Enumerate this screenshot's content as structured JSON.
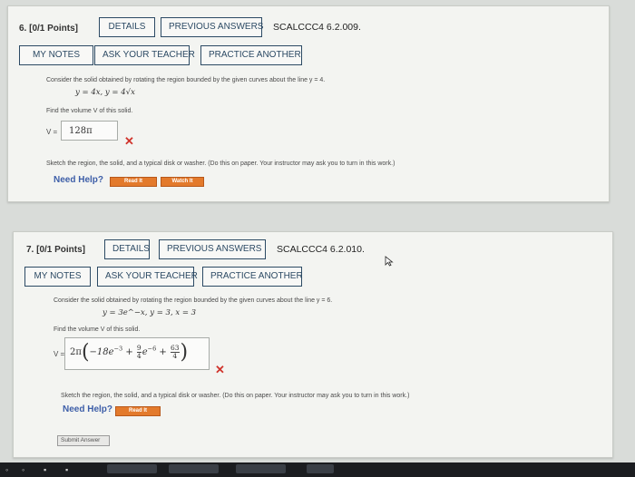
{
  "q6": {
    "points": "6. [0/1 Points]",
    "details": "DETAILS",
    "prev_answers": "PREVIOUS ANSWERS",
    "ref": "SCALCCC4 6.2.009.",
    "my_notes": "MY NOTES",
    "ask_teacher": "ASK YOUR TEACHER",
    "practice": "PRACTICE ANOTHER",
    "question": "Consider the solid obtained by rotating the region bounded by the given curves about the line y = 4.",
    "curves": "y = 4x,  y = 4√x",
    "find": "Find the volume V of this solid.",
    "v_label": "V =",
    "answer": "128π",
    "sketch": "Sketch the region, the solid, and a typical disk or washer. (Do this on paper. Your instructor may ask you to turn in this work.)",
    "need_help": "Need Help?",
    "read_it": "Read It",
    "watch_it": "Watch It",
    "xmark": "✕"
  },
  "q7": {
    "points": "7. [0/1 Points]",
    "details": "DETAILS",
    "prev_answers": "PREVIOUS ANSWERS",
    "ref": "SCALCCC4 6.2.010.",
    "my_notes": "MY NOTES",
    "ask_teacher": "ASK YOUR TEACHER",
    "practice": "PRACTICE ANOTHER",
    "question": "Consider the solid obtained by rotating the region bounded by the given curves about the line y = 6.",
    "curves": "y = 3e^−x,  y = 3,  x = 3",
    "find": "Find the volume V of this solid.",
    "v_label": "V =",
    "answer": {
      "a": "2π",
      "b": "−18e",
      "b_exp": "−3",
      "plus1": "+",
      "frac1_num": "9",
      "frac1_den": "4",
      "c": "e",
      "c_exp": "−6",
      "plus2": "+",
      "frac2_num": "63",
      "frac2_den": "4"
    },
    "sketch": "Sketch the region, the solid, and a typical disk or washer. (Do this on paper. Your instructor may ask you to turn in this work.)",
    "need_help": "Need Help?",
    "read_it": "Read It",
    "submit": "Submit Answer",
    "xmark": "✕"
  },
  "colors": {
    "button_border": "#2c4a64",
    "error_red": "#d0342c",
    "help_blue": "#3d5ea8",
    "orange": "#e37a2c"
  }
}
